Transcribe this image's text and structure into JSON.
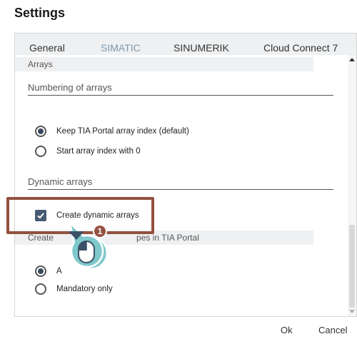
{
  "window": {
    "title": "Settings"
  },
  "tabs": [
    {
      "label": "General",
      "active": false
    },
    {
      "label": "SIMATIC",
      "active": true
    },
    {
      "label": "SINUMERIK",
      "active": false
    },
    {
      "label": "Cloud Connect 7",
      "active": false
    }
  ],
  "sections": {
    "arrays_header": "Arrays",
    "numbering_label": "Numbering of arrays",
    "numbering_options": [
      {
        "label": "Keep TIA Portal array index (default)",
        "selected": true
      },
      {
        "label": "Start array index with 0",
        "selected": false
      }
    ],
    "dynamic_label": "Dynamic arrays",
    "dynamic_checkbox": {
      "label": "Create dynamic arrays",
      "checked": true
    },
    "tia_header": "Create ... object types in TIA Portal",
    "tia_header_visible_start": "Create",
    "tia_header_visible_end": "pes in TIA Portal",
    "tia_options": [
      {
        "label": "A",
        "selected": true
      },
      {
        "label": "Mandatory only",
        "selected": false
      }
    ]
  },
  "annotation": {
    "step_number": "1"
  },
  "footer": {
    "ok_label": "Ok",
    "cancel_label": "Cancel"
  },
  "colors": {
    "accent": "#475a72",
    "active_tab": "#7d98ad",
    "highlight": "#94503f",
    "section_bg": "#eef0f2"
  }
}
